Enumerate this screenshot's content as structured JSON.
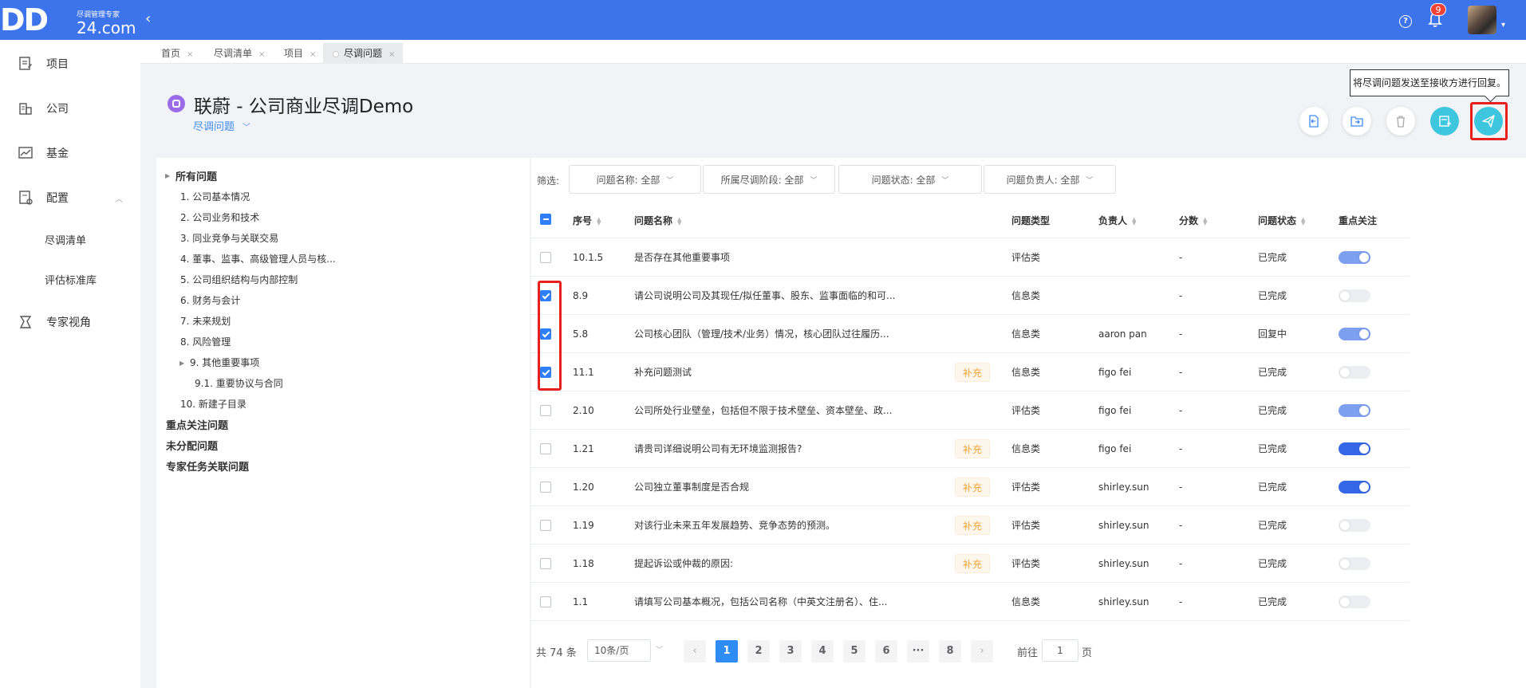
{
  "app": {
    "logo_main": "DD",
    "logo_sub": "尽调管理专家",
    "logo_com": "24.com",
    "collapse_icon": "‹",
    "notification_count": "9"
  },
  "sidebar": {
    "items": [
      {
        "label": "项目",
        "icon": "project-icon"
      },
      {
        "label": "公司",
        "icon": "company-icon"
      },
      {
        "label": "基金",
        "icon": "fund-icon"
      },
      {
        "label": "配置",
        "icon": "config-icon"
      },
      {
        "label": "尽调清单"
      },
      {
        "label": "评估标准库"
      },
      {
        "label": "专家视角",
        "icon": "expert-icon"
      }
    ]
  },
  "tabs": [
    {
      "label": "首页"
    },
    {
      "label": "尽调清单"
    },
    {
      "label": "项目"
    },
    {
      "label": "尽调问题"
    }
  ],
  "header": {
    "title": "联蔚 - 公司商业尽调Demo",
    "subtitle": "尽调问题",
    "tooltip": "将尽调问题发送至接收方进行回复。"
  },
  "tree": {
    "root": "所有问题",
    "children": [
      "1. 公司基本情况",
      "2. 公司业务和技术",
      "3. 同业竞争与关联交易",
      "4. 董事、监事、高级管理人员与核...",
      "5. 公司组织结构与内部控制",
      "6. 财务与会计",
      "7. 未来规划",
      "8. 风险管理",
      "9. 其他重要事项",
      "9.1. 重要协议与合同",
      "10. 新建子目录"
    ],
    "groups": [
      "重点关注问题",
      "未分配问题",
      "专家任务关联问题"
    ]
  },
  "filters": {
    "label": "筛选:",
    "items": [
      "问题名称: 全部",
      "所属尽调阶段: 全部",
      "问题状态: 全部",
      "问题负责人: 全部"
    ]
  },
  "table": {
    "headers": {
      "no": "序号",
      "name": "问题名称",
      "type": "问题类型",
      "owner": "负责人",
      "score": "分数",
      "status": "问题状态",
      "focus": "重点关注"
    },
    "supplement_label": "补充",
    "rows": [
      {
        "checked": false,
        "no": "10.1.5",
        "name": "是否存在其他重要事项",
        "supp": false,
        "type": "评估类",
        "owner": "",
        "score": "-",
        "status": "已完成",
        "focus": "on"
      },
      {
        "checked": true,
        "no": "8.9",
        "name": "请公司说明公司及其现任/拟任董事、股东、监事面临的和可...",
        "supp": false,
        "type": "信息类",
        "owner": "",
        "score": "-",
        "status": "已完成",
        "focus": "off"
      },
      {
        "checked": true,
        "no": "5.8",
        "name": "公司核心团队（管理/技术/业务）情况，核心团队过往履历...",
        "supp": false,
        "type": "信息类",
        "owner": "aaron pan",
        "score": "-",
        "status": "回复中",
        "focus": "on"
      },
      {
        "checked": true,
        "no": "11.1",
        "name": "补充问题测试",
        "supp": true,
        "type": "信息类",
        "owner": "figo fei",
        "score": "-",
        "status": "已完成",
        "focus": "off"
      },
      {
        "checked": false,
        "no": "2.10",
        "name": "公司所处行业壁垒，包括但不限于技术壁垒、资本壁垒、政...",
        "supp": false,
        "type": "评估类",
        "owner": "figo fei",
        "score": "-",
        "status": "已完成",
        "focus": "on"
      },
      {
        "checked": false,
        "no": "1.21",
        "name": "请贵司详细说明公司有无环境监测报告?",
        "supp": true,
        "type": "信息类",
        "owner": "figo fei",
        "score": "-",
        "status": "已完成",
        "focus": "on-dark"
      },
      {
        "checked": false,
        "no": "1.20",
        "name": "公司独立董事制度是否合规",
        "supp": true,
        "type": "评估类",
        "owner": "shirley.sun",
        "score": "-",
        "status": "已完成",
        "focus": "on-dark"
      },
      {
        "checked": false,
        "no": "1.19",
        "name": "对该行业未来五年发展趋势、竞争态势的预测。",
        "supp": true,
        "type": "评估类",
        "owner": "shirley.sun",
        "score": "-",
        "status": "已完成",
        "focus": "off"
      },
      {
        "checked": false,
        "no": "1.18",
        "name": "提起诉讼或仲裁的原因:",
        "supp": true,
        "type": "评估类",
        "owner": "shirley.sun",
        "score": "-",
        "status": "已完成",
        "focus": "off"
      },
      {
        "checked": false,
        "no": "1.1",
        "name": "请填写公司基本概况，包括公司名称（中英文注册名）、住...",
        "supp": false,
        "type": "信息类",
        "owner": "shirley.sun",
        "score": "-",
        "status": "已完成",
        "focus": "off"
      }
    ]
  },
  "pagination": {
    "total": "共 74 条",
    "page_size": "10条/页",
    "pages": [
      "1",
      "2",
      "3",
      "4",
      "5",
      "6",
      "···",
      "8"
    ],
    "current": "1",
    "goto_label": "前往",
    "goto_value": "1",
    "page_suffix": "页"
  },
  "colors": {
    "topbar": "#3d74ec",
    "accent": "#2f7ef5",
    "send_button": "#3dc6dd",
    "highlight": "#e8201d"
  }
}
